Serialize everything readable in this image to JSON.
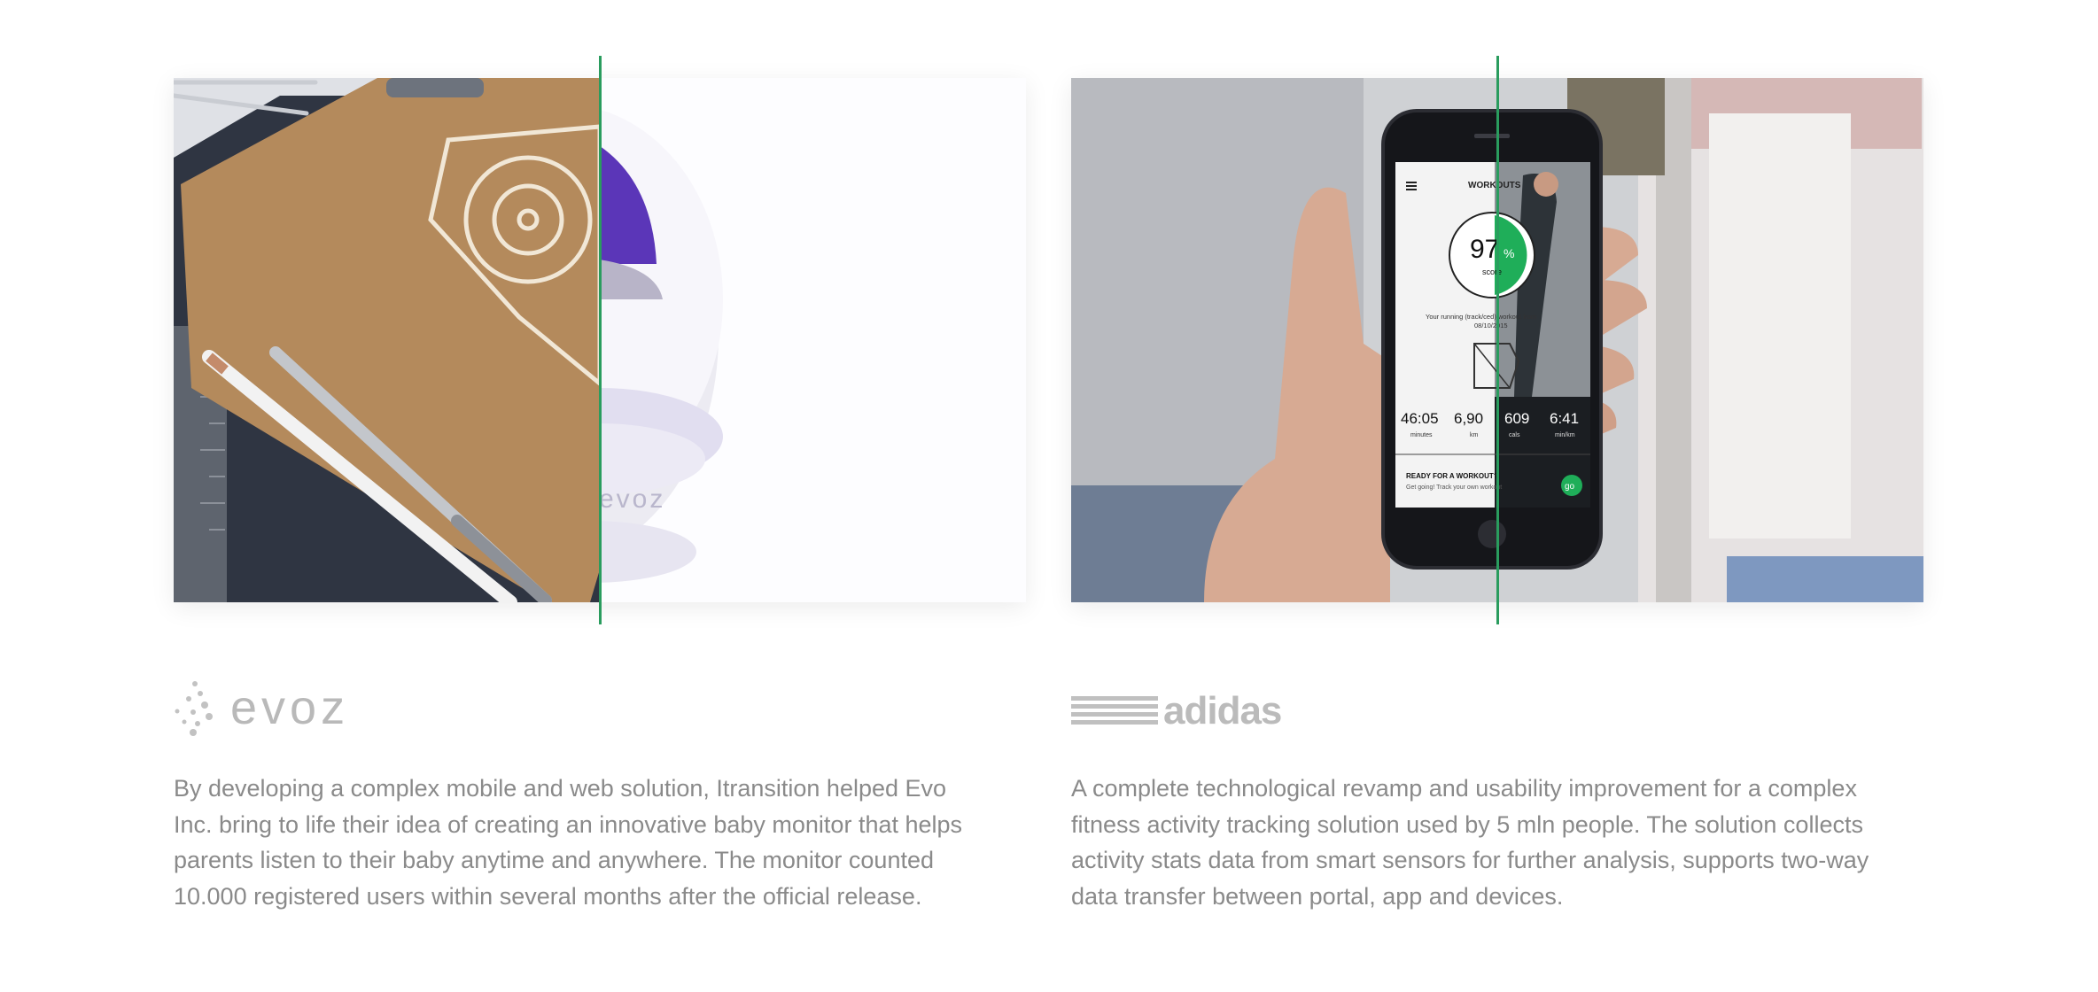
{
  "cases": [
    {
      "logo_text": "evoz",
      "image_watermark": "evoz",
      "description": "By developing a complex mobile and web solution, Itransition helped Evo Inc. bring to life their idea of creating an innovative baby monitor that helps parents listen to their baby anytime and anywhere. The monitor counted 10.000 registered users within several months after the official release."
    },
    {
      "logo_text": "adidas",
      "description": "A complete technological revamp and usability improvement for a complex fitness activity tracking solution used by 5 mln people. The solution collects activity stats data from smart sensors for further analysis, supports two-way data transfer between portal, app and devices.",
      "phone": {
        "header": "WORKOUTS",
        "score_value": "97",
        "score_unit": "%",
        "score_label": "score",
        "workout_line1": "Your running (track/ced) workout from",
        "workout_line2": "08/10/2015",
        "stats": [
          {
            "value": "46:05",
            "label": "minutes"
          },
          {
            "value": "6,90",
            "label": "km"
          },
          {
            "value": "609",
            "label": "cals"
          },
          {
            "value": "6:41",
            "label": "min/km"
          }
        ],
        "cta_title": "READY FOR A WORKOUT?",
        "cta_sub": "Get going! Track your own workout",
        "go_label": "go"
      }
    }
  ],
  "colors": {
    "divider": "#2a9c5e",
    "text": "#8a8a8a",
    "logo": "#b9b9b9",
    "accent_green": "#1fae59",
    "purple": "#5b36b8",
    "kraft": "#b48a5c"
  }
}
